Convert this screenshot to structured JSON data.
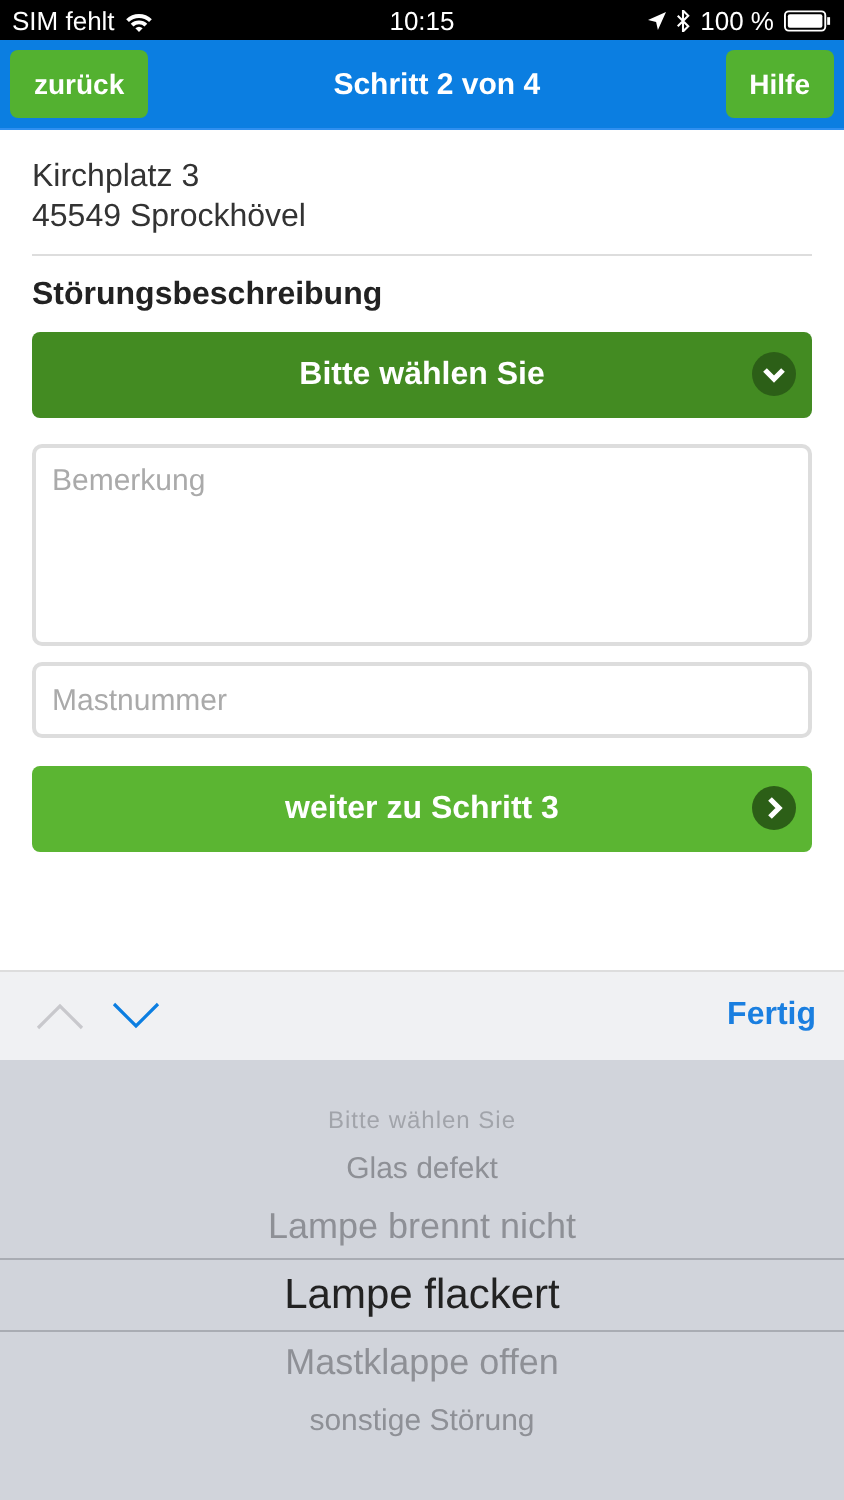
{
  "status_bar": {
    "carrier": "SIM fehlt",
    "time": "10:15",
    "battery": "100 %"
  },
  "nav": {
    "back": "zurück",
    "title": "Schritt 2 von 4",
    "help": "Hilfe"
  },
  "address": [
    "Kirchplatz 3",
    "45549 Sprockhövel"
  ],
  "section_title": "Störungsbeschreibung",
  "select": {
    "value": "Bitte wählen Sie"
  },
  "remark": {
    "placeholder": "Bemerkung"
  },
  "mast": {
    "placeholder": "Mastnummer"
  },
  "next_button": "weiter zu Schritt 3",
  "toolbar": {
    "prev_disabled": true,
    "next_disabled": false,
    "done": "Fertig"
  },
  "picker": [
    {
      "label": "Bitte wählen Sie",
      "selected": false
    },
    {
      "label": "Glas defekt",
      "selected": false
    },
    {
      "label": "Lampe brennt nicht",
      "selected": false
    },
    {
      "label": "Lampe flackert",
      "selected": true
    },
    {
      "label": "Mastklappe offen",
      "selected": false
    },
    {
      "label": "sonstige Störung",
      "selected": false
    }
  ]
}
